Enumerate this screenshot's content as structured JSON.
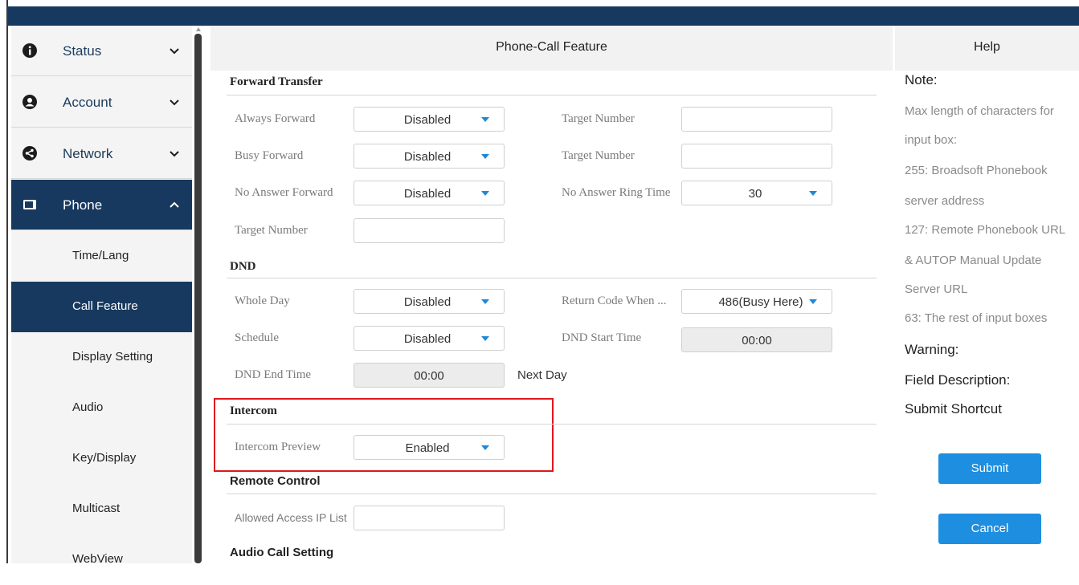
{
  "sidebar": {
    "menus": [
      {
        "label": "Status",
        "icon": "info-icon",
        "expanded": false
      },
      {
        "label": "Account",
        "icon": "user-icon",
        "expanded": false
      },
      {
        "label": "Network",
        "icon": "share-icon",
        "expanded": false
      },
      {
        "label": "Phone",
        "icon": "monitor-icon",
        "expanded": true
      }
    ],
    "sub_items": [
      {
        "label": "Time/Lang"
      },
      {
        "label": "Call Feature",
        "active": true
      },
      {
        "label": "Display Setting"
      },
      {
        "label": "Audio"
      },
      {
        "label": "Key/Display"
      },
      {
        "label": "Multicast"
      },
      {
        "label": "WebView"
      }
    ]
  },
  "main": {
    "title": "Phone-Call Feature",
    "forward": {
      "title": "Forward Transfer",
      "always_label": "Always Forward",
      "always_value": "Disabled",
      "always_target_label": "Target Number",
      "always_target_value": "",
      "busy_label": "Busy Forward",
      "busy_value": "Disabled",
      "busy_target_label": "Target Number",
      "busy_target_value": "",
      "noanswer_label": "No Answer Forward",
      "noanswer_value": "Disabled",
      "ring_time_label": "No Answer Ring Time",
      "ring_time_value": "30",
      "noanswer_target_label": "Target Number",
      "noanswer_target_value": ""
    },
    "dnd": {
      "title": "DND",
      "whole_day_label": "Whole Day",
      "whole_day_value": "Disabled",
      "return_code_label": "Return Code When ...",
      "return_code_value": "486(Busy Here)",
      "schedule_label": "Schedule",
      "schedule_value": "Disabled",
      "start_time_label": "DND Start Time",
      "start_time_value": "00:00",
      "end_time_label": "DND End Time",
      "end_time_value": "00:00",
      "next_day_label": "Next Day"
    },
    "intercom": {
      "title": "Intercom",
      "preview_label": "Intercom Preview",
      "preview_value": "Enabled"
    },
    "remote": {
      "title": "Remote Control",
      "allowed_ip_label": "Allowed Access IP List",
      "allowed_ip_value": ""
    },
    "audio_call": {
      "title": "Audio Call Setting"
    }
  },
  "help": {
    "title": "Help",
    "note_label": "Note:",
    "lines": [
      "Max length of characters for",
      "input box:",
      "255: Broadsoft Phonebook",
      "server address",
      "127: Remote Phonebook URL",
      "& AUTOP Manual Update",
      "Server URL",
      "63: The rest of input boxes"
    ],
    "warning_label": "Warning:",
    "field_desc_label": "Field Description:",
    "submit_shortcut_label": "Submit Shortcut",
    "submit_label": "Submit",
    "cancel_label": "Cancel"
  },
  "colors": {
    "navy": "#17395f",
    "accent_blue": "#1e8ee0",
    "highlight_red": "#e0171d"
  }
}
